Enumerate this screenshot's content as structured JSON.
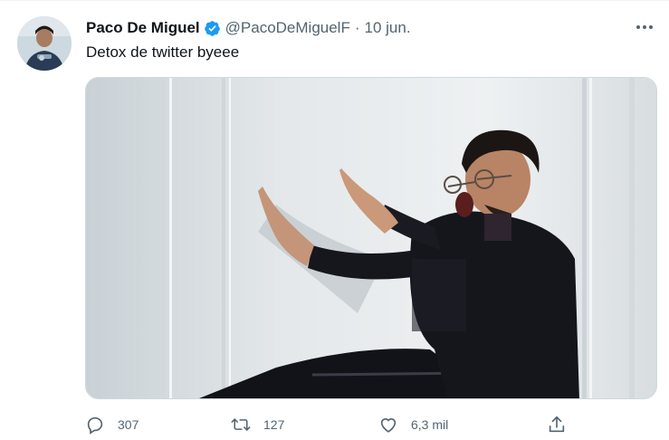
{
  "tweet": {
    "author": {
      "name": "Paco De Miguel",
      "handle": "@PacoDeMiguelF",
      "verified": true
    },
    "separator": "·",
    "date": "10 jun.",
    "text": "Detox de twitter byeee",
    "media": {
      "kind": "photo"
    },
    "actions": {
      "reply_count": "307",
      "retweet_count": "127",
      "like_count": "6,3 mil"
    }
  },
  "colors": {
    "verified_blue": "#1d9bf0",
    "secondary_text": "#536471",
    "primary_text": "#0f1419"
  },
  "icons": [
    "more-icon",
    "verified-badge-icon",
    "reply-icon",
    "retweet-icon",
    "like-icon",
    "share-icon"
  ]
}
